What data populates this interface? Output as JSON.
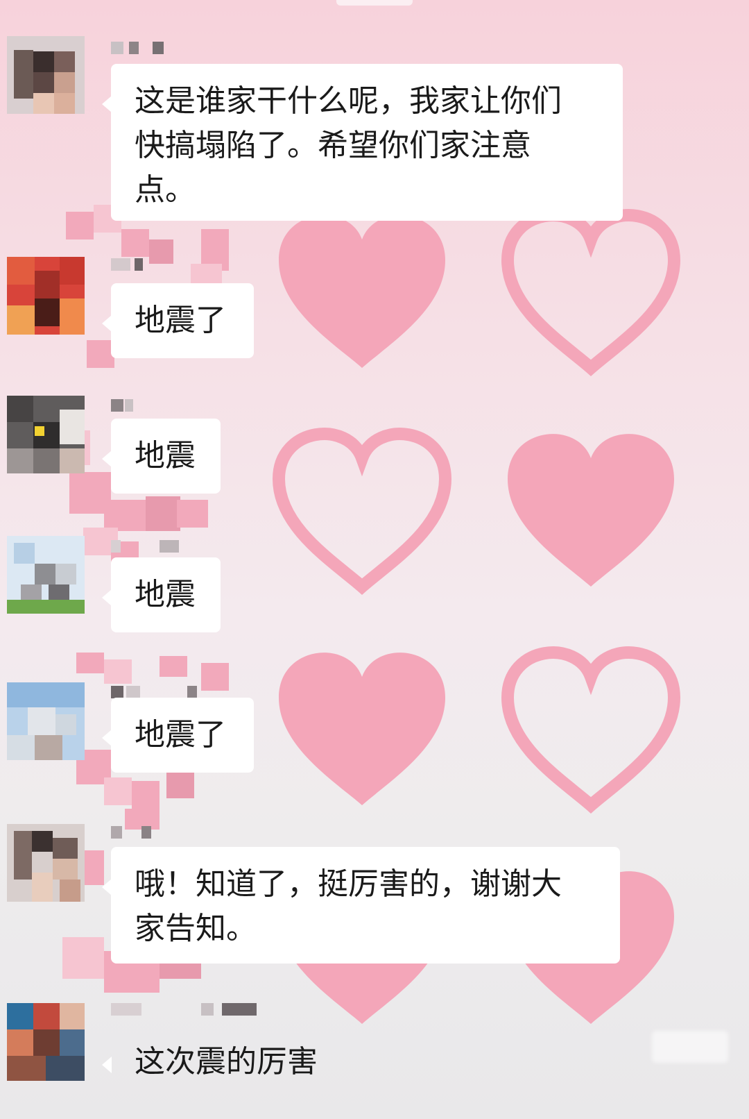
{
  "messages": [
    {
      "text": "这是谁家干什么呢，我家让你们快搞塌陷了。希望你们家注意点。",
      "lines": [
        "这是谁家干什么呢，我家让你们",
        "快搞塌陷了。希望你们家注意",
        "点。"
      ]
    },
    {
      "text": "地震了",
      "lines": [
        "地震了"
      ]
    },
    {
      "text": "地震",
      "lines": [
        "地震"
      ]
    },
    {
      "text": "地震",
      "lines": [
        "地震"
      ]
    },
    {
      "text": "地震了",
      "lines": [
        "地震了"
      ]
    },
    {
      "text": "哦！知道了，挺厉害的，谢谢大家告知。",
      "lines": [
        "哦！知道了，挺厉害的，谢谢大",
        "家告知。"
      ]
    },
    {
      "text": "这次震的厉害",
      "lines": [
        "这次震的厉害"
      ]
    }
  ],
  "colors": {
    "bubble": "#ffffff",
    "heart": "#f4a6b9",
    "text": "#1a1a1a"
  },
  "icons": {
    "background": "heart-pattern",
    "avatar": "pixelated-avatar",
    "sender_name": "pixelated-name"
  }
}
